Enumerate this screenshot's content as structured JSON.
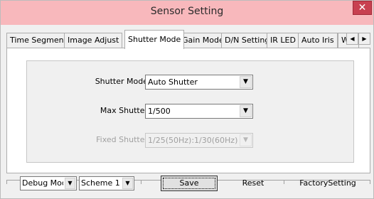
{
  "window": {
    "title": "Sensor Setting",
    "close_glyph": "✕"
  },
  "tabs": [
    {
      "label": "Time Segment"
    },
    {
      "label": "Image Adjust"
    },
    {
      "label": "Shutter Mode"
    },
    {
      "label": "Gain Mode"
    },
    {
      "label": "D/N Setting"
    },
    {
      "label": "IR LED"
    },
    {
      "label": "Auto Iris"
    },
    {
      "label": "WDR"
    }
  ],
  "active_tab": "Shutter Mode",
  "tab_scroll": {
    "left": "◀",
    "right": "▶"
  },
  "shutter_panel": {
    "shutter_mode": {
      "label": "Shutter Mode",
      "value": "Auto Shutter"
    },
    "max_shutter": {
      "label": "Max Shutter",
      "value": "1/500"
    },
    "fixed_shutter": {
      "label": "Fixed Shutter",
      "value": "1/25(50Hz):1/30(60Hz)",
      "disabled": true
    }
  },
  "dropdown_arrow": "▼",
  "bottom": {
    "debug_mode": "Debug Mode",
    "scheme": "Scheme 1",
    "save_label": "Save",
    "reset_label": "Reset",
    "factory_label": "FactorySetting"
  }
}
